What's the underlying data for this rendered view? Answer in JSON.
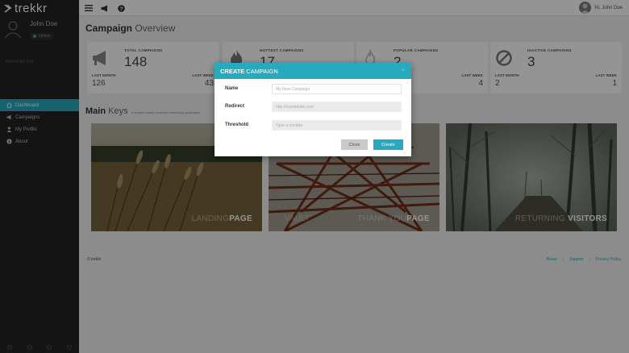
{
  "app": {
    "brand": "trekkr"
  },
  "user": {
    "name": "John Doe",
    "status": "Online"
  },
  "sidebar": {
    "heading": "NAVIGATION",
    "items": [
      {
        "label": "Dashboard",
        "icon": "home-icon",
        "active": true
      },
      {
        "label": "Campaigns",
        "icon": "megaphone-icon",
        "active": false
      },
      {
        "label": "My Profile",
        "icon": "user-icon",
        "active": false
      },
      {
        "label": "About",
        "icon": "info-icon",
        "active": false
      }
    ]
  },
  "topbar": {
    "greeting": "Hi, John Doe"
  },
  "overview": {
    "title_bold": "Campaign",
    "title_light": " Overview",
    "cards": [
      {
        "label": "TOTAL CAMPAIGNS",
        "value": "148",
        "last_month_label": "LAST MONTH",
        "last_month": "126",
        "last_week_label": "LAST WEEK",
        "last_week": "43",
        "icon": "megaphone-icon"
      },
      {
        "label": "HOTTEST CAMPAIGNS",
        "value": "17",
        "last_month_label": "",
        "last_month": "",
        "last_week_label": "",
        "last_week": "",
        "icon": "flame-icon"
      },
      {
        "label": "POPULAR CAMPAIGNS",
        "value": "2",
        "last_month_label": "LAST MONTH",
        "last_month": "",
        "last_week_label": "LAST WEEK",
        "last_week": "4",
        "icon": "fire-icon"
      },
      {
        "label": "INACTIVE CAMPAIGNS",
        "value": "3",
        "last_month_label": "LAST MONTH",
        "last_month": "2",
        "last_week_label": "LAST WEEK",
        "last_week": "1",
        "icon": "ban-icon"
      }
    ]
  },
  "keys": {
    "title_bold": "Main",
    "title_light": " Keys",
    "subtitle": "A domain based centralize marketing application",
    "photos": [
      {
        "cap_light": "LANDING",
        "cap_bold": "PAGE",
        "scene": "wheat-field"
      },
      {
        "cap_light": "THANK YOU",
        "cap_bold": "PAGE",
        "cap_prefix": "VAULT",
        "scene": "steel-tower"
      },
      {
        "cap_light": "RETURNING ",
        "cap_bold": "VISITORS",
        "scene": "misty-forest"
      }
    ]
  },
  "footer": {
    "copyright": "© trekkr",
    "links": [
      "About",
      "Support",
      "Privacy Policy"
    ],
    "sep": "|"
  },
  "modal": {
    "title_bold": "CREATE",
    "title_light": "CAMPAIGN",
    "close_x": "×",
    "fields": [
      {
        "label": "Name",
        "placeholder": "My New Campaign"
      },
      {
        "label": "Redirect",
        "placeholder": "http://mywebsite.com"
      },
      {
        "label": "Threshold",
        "placeholder": "Type a number"
      }
    ],
    "close_label": "Close",
    "create_label": "Create"
  },
  "colors": {
    "accent": "#27aabe",
    "sidebar": "#242424"
  }
}
